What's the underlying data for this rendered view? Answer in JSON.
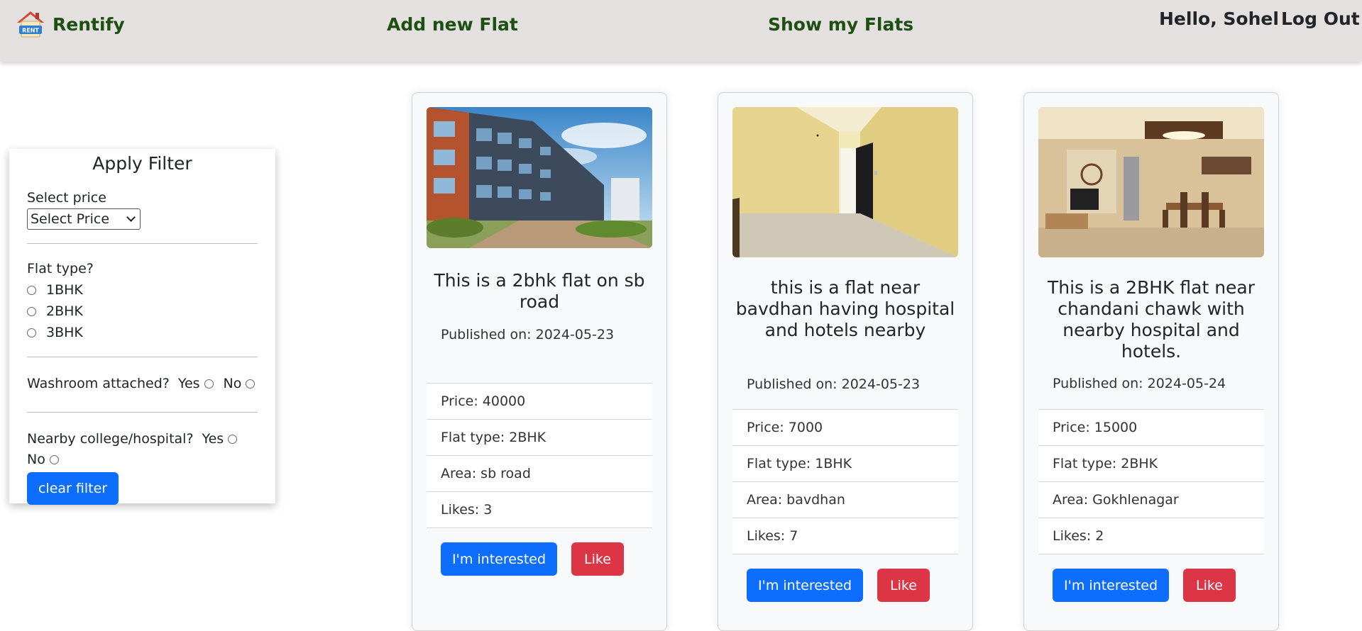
{
  "nav": {
    "brand": "Rentify",
    "add_flat": "Add new Flat",
    "show_flats": "Show my Flats",
    "greeting": "Hello, Sohel",
    "logout": "Log Out",
    "logo_text": "RENT"
  },
  "filter": {
    "title": "Apply Filter",
    "price_label": "Select price",
    "price_selected": "Select Price",
    "flat_type_label": "Flat type?",
    "flat_types": [
      "1BHK",
      "2BHK",
      "3BHK"
    ],
    "washroom_label": "Washroom attached?",
    "nearby_label": "Nearby college/hospital?",
    "yes": "Yes",
    "no": "No",
    "clear_button": "clear filter"
  },
  "flats": [
    {
      "title": "This is a 2bhk flat on sb road",
      "published": "Published on: 2024-05-23",
      "price": "Price: 40000",
      "flat_type": "Flat type: 2BHK",
      "area": "Area: sb road",
      "likes": "Likes: 3"
    },
    {
      "title": "this is a flat near bavdhan having hospital and hotels nearby",
      "published": "Published on: 2024-05-23",
      "price": "Price: 7000",
      "flat_type": "Flat type: 1BHK",
      "area": "Area: bavdhan",
      "likes": "Likes: 7"
    },
    {
      "title": "This is a 2BHK flat near chandani chawk with nearby hospital and hotels.",
      "published": "Published on: 2024-05-24",
      "price": "Price: 15000",
      "flat_type": "Flat type: 2BHK",
      "area": "Area: Gokhlenagar",
      "likes": "Likes: 2"
    }
  ],
  "buttons": {
    "interested": "I'm interested",
    "like": "Like"
  },
  "colors": {
    "navbar_bg": "#e3e0df",
    "nav_link": "#1d4f12",
    "primary": "#0d6efd",
    "danger": "#dc3545"
  }
}
